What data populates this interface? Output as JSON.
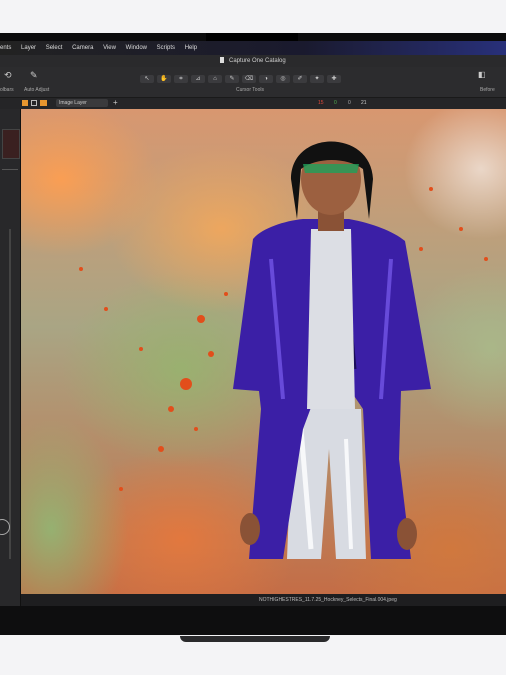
{
  "app": {
    "window_title": "Capture One Catalog",
    "menu": [
      "ents",
      "Layer",
      "Select",
      "Camera",
      "View",
      "Window",
      "Scripts",
      "Help"
    ]
  },
  "toolbar": {
    "left_labels": [
      "olbars",
      "Auto Adjust"
    ],
    "center_label": "Cursor Tools",
    "right_label": "Before",
    "tools": [
      "pan-tool-icon",
      "crop-tool-icon",
      "straighten-tool-icon",
      "keystone-tool-icon",
      "brush-tool-icon",
      "eraser-tool-icon",
      "gradient-tool-icon",
      "radial-tool-icon",
      "picker-tool-icon",
      "clone-tool-icon",
      "heal-tool-icon"
    ]
  },
  "subbar": {
    "layer_select": "Image Layer",
    "counts": [
      "15",
      "0",
      "0",
      "21"
    ]
  },
  "status": {
    "filename": "NOTHIGHESTRES_11.7.25_Hockney_Selects_Final.004.jpeg"
  },
  "colors": {
    "accent_orange": "#e8962f",
    "count_red": "#e04a3a",
    "count_green": "#4fb24f",
    "jacket_purple": "#3b1fa6"
  }
}
